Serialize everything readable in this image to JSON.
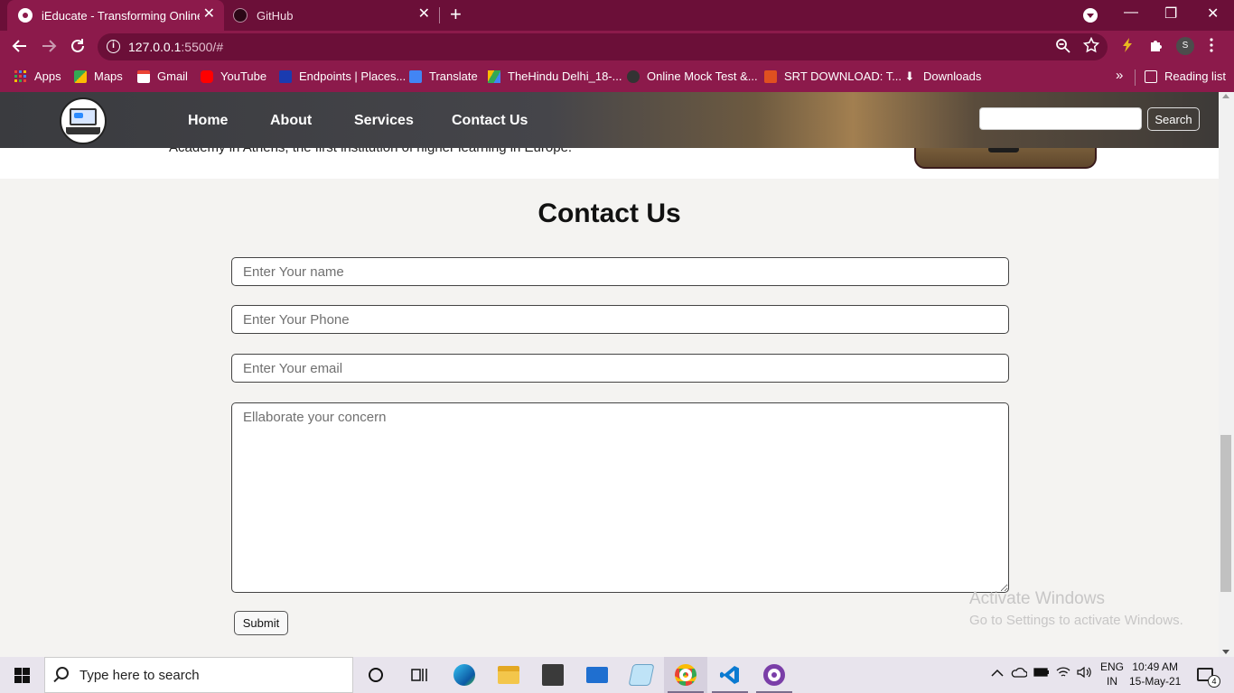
{
  "browser": {
    "tabs": [
      {
        "title": "iEducate - Transforming Online E",
        "close": "✕"
      },
      {
        "title": "GitHub",
        "close": "✕"
      }
    ],
    "new_tab": "+",
    "window_controls": {
      "minimize": "—",
      "restore": "❐",
      "close": "✕"
    },
    "url_host": "127.0.0.1",
    "url_rest": ":5500/#",
    "profile_initial": "S",
    "bookmarks": [
      {
        "label": "Apps",
        "icon": "apps-grid-icon",
        "color": "#4285f4"
      },
      {
        "label": "Maps",
        "icon": "maps-icon",
        "color": "#34a853"
      },
      {
        "label": "Gmail",
        "icon": "gmail-icon",
        "color": "#ea4335"
      },
      {
        "label": "YouTube",
        "icon": "youtube-icon",
        "color": "#ff0000"
      },
      {
        "label": "Endpoints | Places...",
        "icon": "endpoints-icon",
        "color": "#1a3bb0"
      },
      {
        "label": "Translate",
        "icon": "translate-icon",
        "color": "#4285f4"
      },
      {
        "label": "TheHindu Delhi_18-...",
        "icon": "drive-icon",
        "color": "#fbbc04"
      },
      {
        "label": "Online Mock Test &...",
        "icon": "mock-test-icon",
        "color": "#333333"
      },
      {
        "label": "SRT DOWNLOAD: T...",
        "icon": "srt-icon",
        "color": "#e05020"
      },
      {
        "label": "Downloads",
        "icon": "download-icon",
        "color": "#ffffff"
      }
    ],
    "more_bookmarks": "»",
    "reading_list": "Reading list"
  },
  "site": {
    "nav": [
      "Home",
      "About",
      "Services",
      "Contact Us"
    ],
    "search_button": "Search",
    "search_value": "",
    "about_text": "Academy in Athens, the first institution of higher learning in Europe."
  },
  "contact": {
    "title": "Contact Us",
    "name_placeholder": "Enter Your name",
    "phone_placeholder": "Enter Your Phone",
    "email_placeholder": "Enter Your email",
    "concern_placeholder": "Ellaborate your concern",
    "submit_label": "Submit"
  },
  "watermark": {
    "line1": "Activate Windows",
    "line2": "Go to Settings to activate Windows."
  },
  "taskbar": {
    "search_placeholder": "Type here to search",
    "lang_line1": "ENG",
    "lang_line2": "IN",
    "time": "10:49 AM",
    "date": "15-May-21",
    "notification_count": "4"
  }
}
